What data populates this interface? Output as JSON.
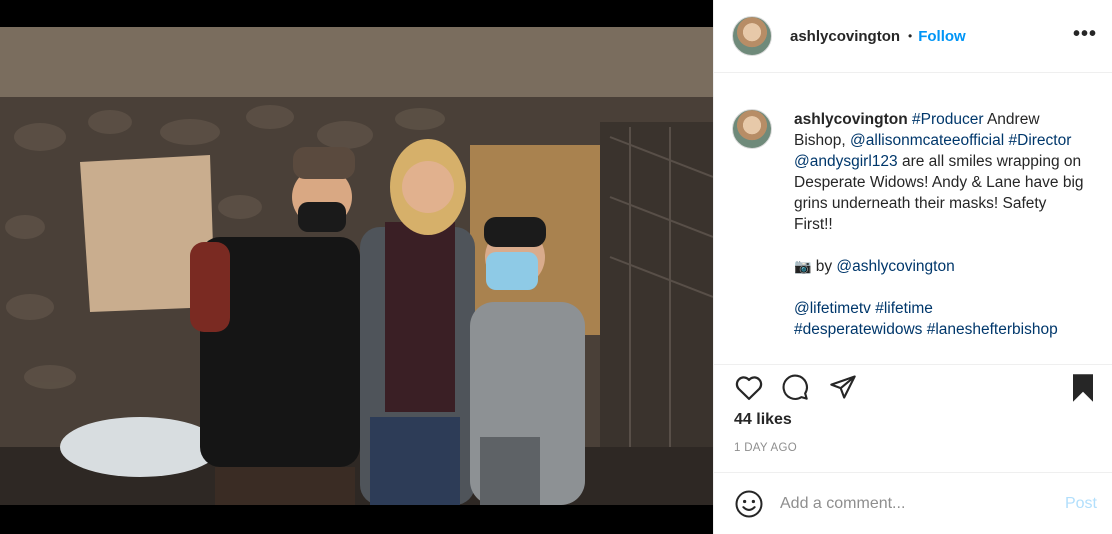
{
  "post": {
    "username": "ashlycovington",
    "follow_label": "Follow",
    "separator": "•",
    "more_label": "•••"
  },
  "caption": {
    "username": "ashlycovington",
    "part1": " ",
    "tag_producer": "#Producer",
    "part2": " Andrew Bishop, ",
    "mention_allison": "@allisonmcateeofficial",
    "part3": " ",
    "tag_director": "#Director",
    "part4": " ",
    "mention_andy": "@andysgirl123",
    "part5": " are all smiles wrapping on Desperate Widows! Andy & Lane have big grins underneath their masks! Safety First!!",
    "camera_emoji": "📷",
    "photo_by_text": " by ",
    "photo_by_mention": "@ashlycovington",
    "tag_lifetimetv": "@lifetimetv",
    "tag_lifetime": "#lifetime",
    "tag_desperatewidows": "#desperatewidows",
    "tag_laneshefterbishop": "#laneshefterbishop"
  },
  "stats": {
    "likes": "44 likes",
    "time": "1 DAY AGO"
  },
  "comment": {
    "placeholder": "Add a comment...",
    "post_label": "Post"
  },
  "icons": {
    "like": "heart-icon",
    "comment": "comment-icon",
    "share": "share-icon",
    "save": "bookmark-icon",
    "emoji": "emoji-icon"
  },
  "colors": {
    "link": "#00376b",
    "follow": "#0095f6",
    "post_disabled": "#b2dffc",
    "muted": "#8e8e8e"
  }
}
